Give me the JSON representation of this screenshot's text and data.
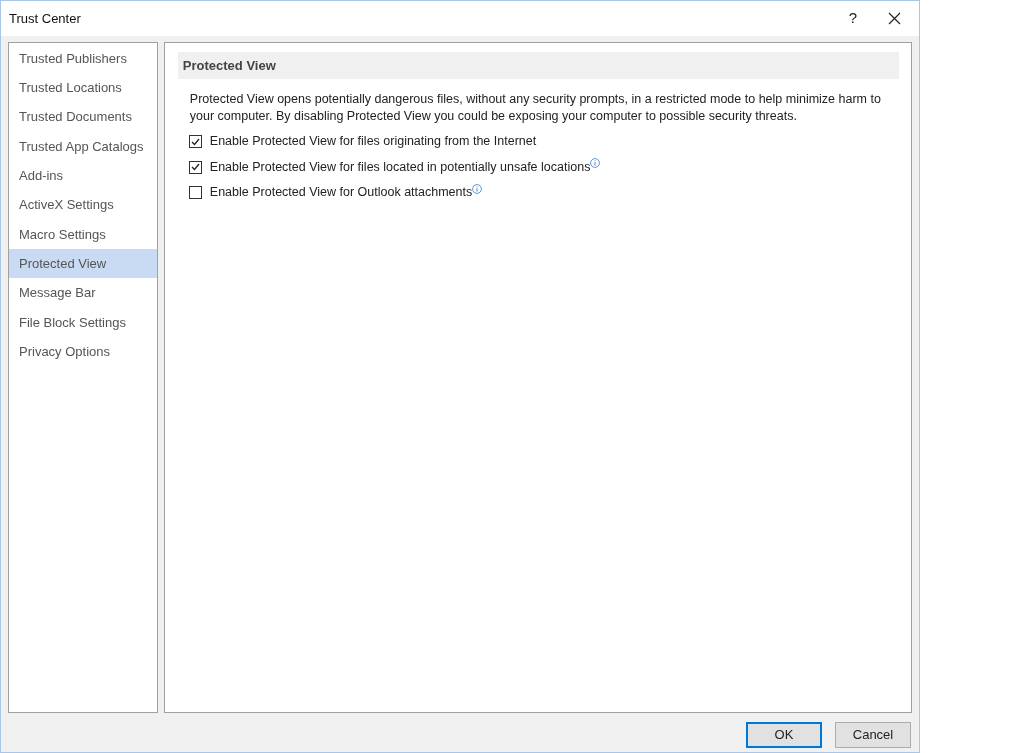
{
  "window": {
    "title": "Trust Center",
    "help": "?"
  },
  "sidebar": {
    "items": [
      {
        "label": "Trusted Publishers",
        "selected": false
      },
      {
        "label": "Trusted Locations",
        "selected": false
      },
      {
        "label": "Trusted Documents",
        "selected": false
      },
      {
        "label": "Trusted App Catalogs",
        "selected": false
      },
      {
        "label": "Add-ins",
        "selected": false
      },
      {
        "label": "ActiveX Settings",
        "selected": false
      },
      {
        "label": "Macro Settings",
        "selected": false
      },
      {
        "label": "Protected View",
        "selected": true
      },
      {
        "label": "Message Bar",
        "selected": false
      },
      {
        "label": "File Block Settings",
        "selected": false
      },
      {
        "label": "Privacy Options",
        "selected": false
      }
    ]
  },
  "section": {
    "title": "Protected View",
    "description": "Protected View opens potentially dangerous files, without any security prompts, in a restricted mode to help minimize harm to your computer. By disabling Protected View you could be exposing your computer to possible security threats.",
    "options": [
      {
        "label": "Enable Protected View for files originating from the Internet",
        "checked": true,
        "info": false
      },
      {
        "label": "Enable Protected View for files located in potentially unsafe locations",
        "checked": true,
        "info": true
      },
      {
        "label": "Enable Protected View for Outlook attachments",
        "checked": false,
        "info": true
      }
    ]
  },
  "buttons": [
    {
      "label": "OK",
      "default": true
    },
    {
      "label": "Cancel",
      "default": false
    }
  ]
}
